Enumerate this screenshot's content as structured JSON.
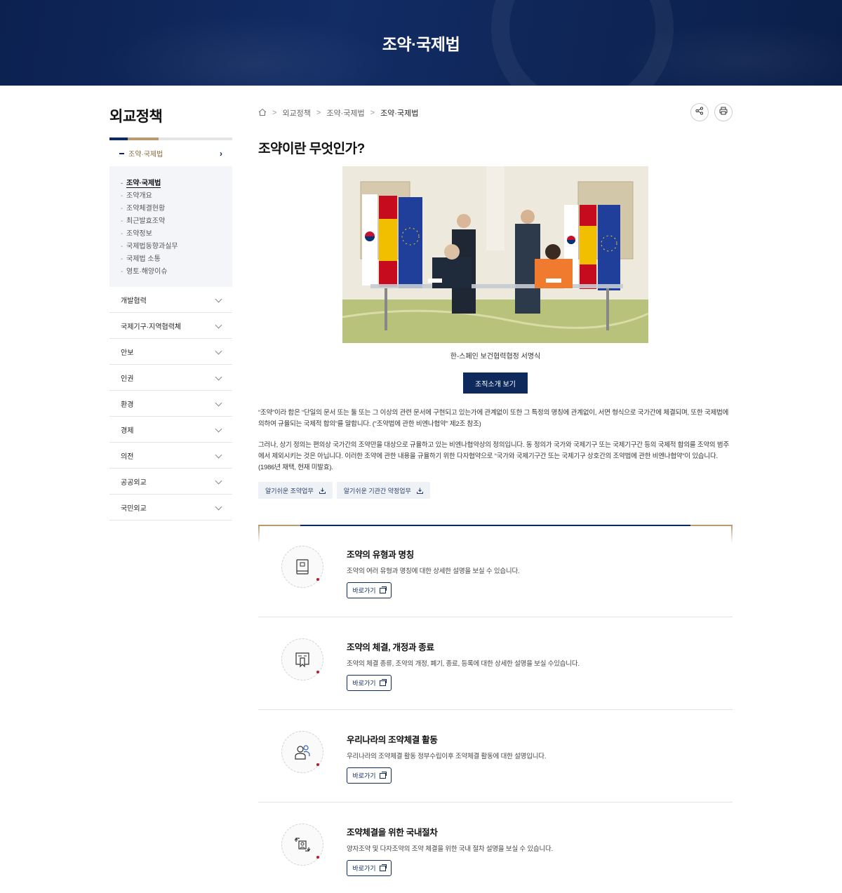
{
  "banner": {
    "title": "조약·국제법"
  },
  "sidebar": {
    "title": "외교정책",
    "active_label": "조약·국제법",
    "sub_items": [
      {
        "label": "조약·국제법",
        "active": true
      },
      {
        "label": "조약개요"
      },
      {
        "label": "조약체결현황"
      },
      {
        "label": "최근발효조약"
      },
      {
        "label": "조약정보"
      },
      {
        "label": "국제법동향과실무"
      },
      {
        "label": "국제법 소통"
      },
      {
        "label": "영토·해양이슈"
      }
    ],
    "items": [
      {
        "label": "개발협력"
      },
      {
        "label": "국제기구·지역협력체"
      },
      {
        "label": "안보"
      },
      {
        "label": "인권"
      },
      {
        "label": "환경"
      },
      {
        "label": "경제"
      },
      {
        "label": "의전"
      },
      {
        "label": "공공외교"
      },
      {
        "label": "국민외교"
      }
    ]
  },
  "breadcrumb": {
    "home_icon": "home-icon",
    "level1": "외교정책",
    "level2": "조약·국제법",
    "current": "조약·국제법"
  },
  "tools": {
    "share_icon": "share-icon",
    "print_icon": "print-icon"
  },
  "main": {
    "title": "조약이란 무엇인가?",
    "photo_caption": "한-스페인 보건협력협정 서명식",
    "org_button": "조직소개 보기",
    "para1": "“조약”이라 함은 “단일의 문서 또는 둘 또는 그 이상의 관련 문서에 구현되고 있는가에 관계없이 또한 그 특정의 명칭에 관계없이, 서면 형식으로 국가간에 체결되며, 또한 국제법에 의하여 규율되는 국제적 합의”를 말합니다. (“조약법에 관한 비엔나협약” 제2조 참조)",
    "para2": "그러나, 상기 정의는 편의상 국가간의 조약만을 대상으로 규율하고 있는 비엔나협약상의 정의입니다. 동 정의가 국가와 국제기구 또는 국제기구간 등의 국제적 합의를 조약의 범주에서 제외시키는 것은 아닙니다. 이러한 조약에 관한 내용을 규율하기 위한 다자협약으로 “국가와 국제기구간 또는 국제기구 상호간의 조약법에 관한 비엔나협약”이 있습니다.(1986년 채택, 현재 미발효).",
    "downloads": [
      {
        "label": "알기쉬운 조약업무"
      },
      {
        "label": "알기쉬운 기관간 약정업무"
      }
    ]
  },
  "cards": [
    {
      "icon": "book-icon",
      "title": "조약의 유형과 명칭",
      "desc": "조약의 여러 유형과 명칭에 대한 상세한 설명을 보실 수 있습니다.",
      "button": "바로가기"
    },
    {
      "icon": "document-bookmark-icon",
      "title": "조약의 체결, 개정과 종료",
      "desc": "조약의 체결 종류, 조약의 개정, 폐기, 종료, 등록에 대한 상세한 설명을 보실 수있습니다.",
      "button": "바로가기"
    },
    {
      "icon": "people-icon",
      "title": "우리나라의 조약체결 활동",
      "desc": "우리나라의 조약체결 활동 정부수립이후 조약체결 활동에 대한 설명입니다.",
      "button": "바로가기"
    },
    {
      "icon": "procedure-icon",
      "title": "조약체결을 위한 국내절차",
      "desc": "양자조약 및 다자조약의 조약 체결을 위한 국내 절차 설명을 보실 수 있습니다.",
      "button": "바로가기"
    }
  ]
}
